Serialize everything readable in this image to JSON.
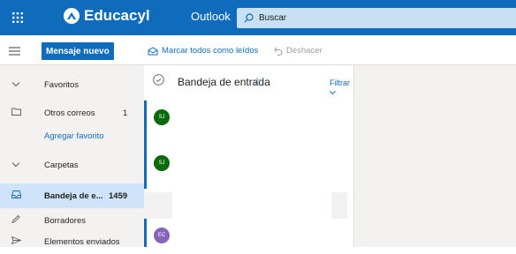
{
  "topbar": {
    "brand": "Educacyl",
    "app": "Outlook",
    "search_placeholder": "Buscar",
    "colors": {
      "bar": "#0f6cbd",
      "search": "#c7e0f4"
    }
  },
  "command_bar": {
    "new_message": "Mensaje nuevo",
    "mark_all_read": "Marcar todos como leídos",
    "undo": "Deshacer"
  },
  "nav": {
    "favorites": "Favoritos",
    "other_mail": {
      "label": "Otros correos",
      "count": "1"
    },
    "add_favorite": "Agregar favorito",
    "folders": "Carpetas",
    "inbox": {
      "label": "Bandeja de e...",
      "count": "1459"
    },
    "drafts": "Borradores",
    "sent": "Elementos enviados"
  },
  "list": {
    "title": "Bandeja de entrada",
    "filter": "Filtrar",
    "messages": [
      {
        "initials": "SJ",
        "color": "#0b6a0b"
      },
      {
        "initials": "SJ",
        "color": "#0b6a0b"
      },
      {
        "initials": "EC",
        "color": "#8764b8"
      }
    ]
  }
}
